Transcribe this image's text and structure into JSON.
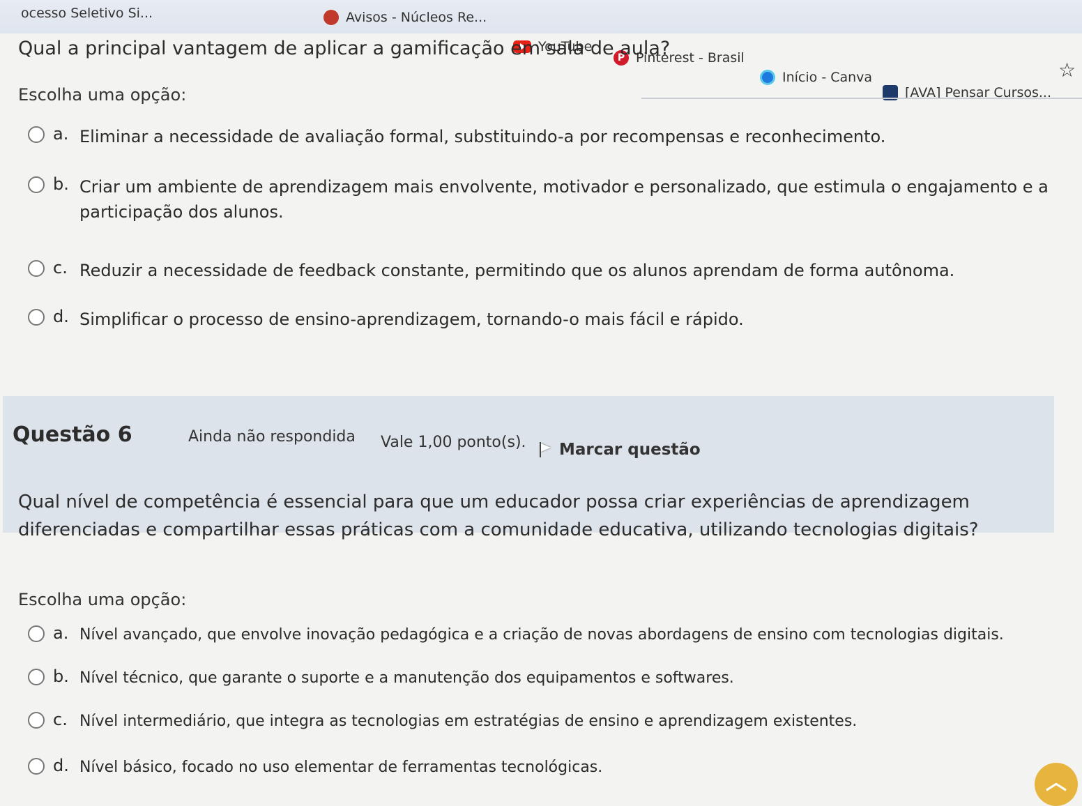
{
  "bookmarks": [
    {
      "label": "ocesso Seletivo Si...",
      "icon": "page-icon"
    },
    {
      "label": "Avisos - Núcleos Re...",
      "icon": "apple-icon"
    },
    {
      "label": "YouTube",
      "icon": "youtube-icon"
    },
    {
      "label": "Pinterest - Brasil",
      "icon": "pinterest-icon"
    },
    {
      "label": "Início - Canva",
      "icon": "canva-icon"
    },
    {
      "label": "[AVA] Pensar Cursos...",
      "icon": "ava-icon"
    }
  ],
  "q5": {
    "title": "Qual a principal vantagem de aplicar a gamificação em sala de aula?",
    "choose": "Escolha uma opção:",
    "options": [
      {
        "letter": "a.",
        "text": "Eliminar a necessidade de avaliação formal, substituindo-a por recompensas e reconhecimento."
      },
      {
        "letter": "b.",
        "text": "Criar um ambiente de aprendizagem mais envolvente, motivador e personalizado, que estimula o engajamento e a participação dos alunos."
      },
      {
        "letter": "c.",
        "text": "Reduzir a necessidade de feedback constante, permitindo que os alunos aprendam de forma autônoma."
      },
      {
        "letter": "d.",
        "text": "Simplificar o processo de ensino-aprendizagem, tornando-o mais fácil e rápido."
      }
    ]
  },
  "q6": {
    "number": "Questão 6",
    "status": "Ainda não respondida",
    "points": "Vale 1,00 ponto(s).",
    "flag": "Marcar questão",
    "text": "Qual nível de competência é essencial para que um educador possa criar experiências de aprendizagem diferenciadas e compartilhar essas práticas com a comunidade educativa, utilizando tecnologias digitais?",
    "choose": "Escolha uma opção:",
    "options": [
      {
        "letter": "a.",
        "text": "Nível avançado, que envolve inovação pedagógica e a criação de novas abordagens de ensino com tecnologias digitais."
      },
      {
        "letter": "b.",
        "text": "Nível técnico, que garante o suporte e a manutenção dos equipamentos e softwares."
      },
      {
        "letter": "c.",
        "text": "Nível intermediário, que integra as tecnologias em estratégias de ensino e aprendizagem existentes."
      },
      {
        "letter": "d.",
        "text": "Nível básico, focado no uso elementar de ferramentas tecnológicas."
      }
    ]
  }
}
